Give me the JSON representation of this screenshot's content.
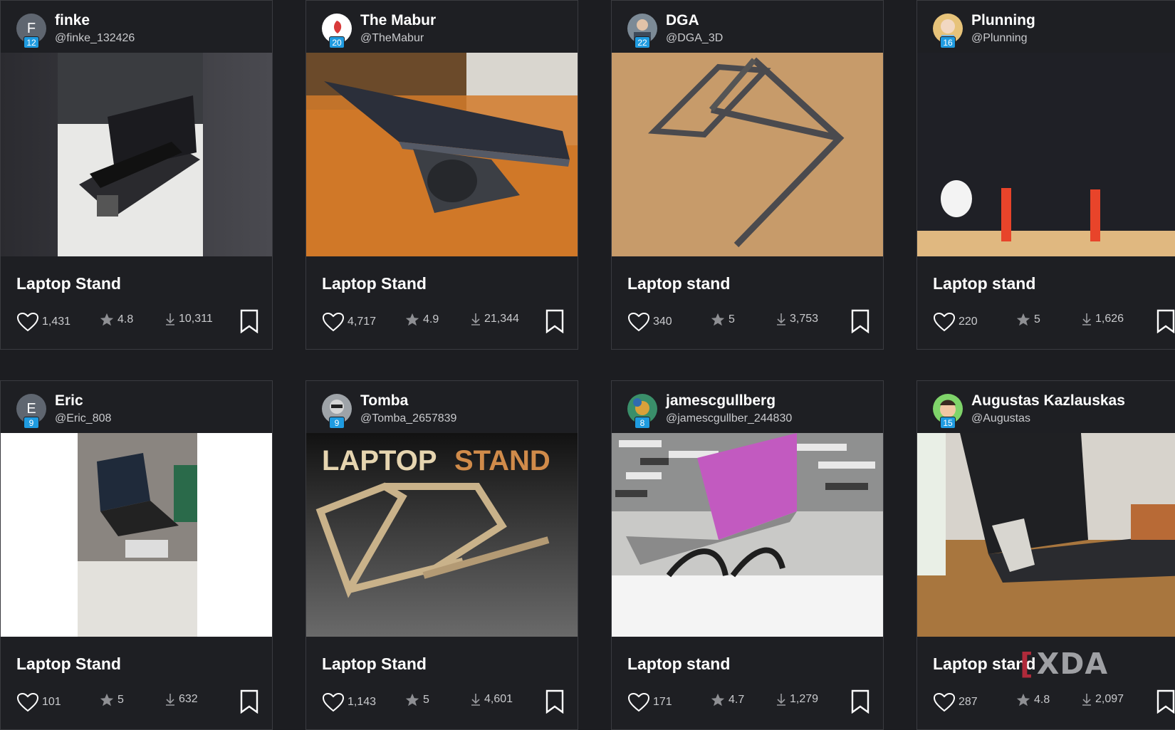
{
  "cards": [
    {
      "user": "finke",
      "handle": "@finke_132426",
      "level": "12",
      "avatar_letter": "F",
      "avatar_color": "#5f6670",
      "title": "Laptop Stand",
      "likes": "1,431",
      "rating": "4.8",
      "downloads": "10,311"
    },
    {
      "user": "The Mabur",
      "handle": "@TheMabur",
      "level": "20",
      "avatar_letter": "",
      "avatar_color": "#ffffff",
      "title": "Laptop Stand",
      "likes": "4,717",
      "rating": "4.9",
      "downloads": "21,344"
    },
    {
      "user": "DGA",
      "handle": "@DGA_3D",
      "level": "22",
      "avatar_letter": "",
      "avatar_color": "#7c8a96",
      "title": "Laptop stand",
      "likes": "340",
      "rating": "5",
      "downloads": "3,753"
    },
    {
      "user": "Plunning",
      "handle": "@Plunning",
      "level": "16",
      "avatar_letter": "",
      "avatar_color": "#e7c37a",
      "title": "Laptop stand",
      "likes": "220",
      "rating": "5",
      "downloads": "1,626"
    },
    {
      "user": "Eric",
      "handle": "@Eric_808",
      "level": "9",
      "avatar_letter": "E",
      "avatar_color": "#5f6670",
      "title": "Laptop Stand",
      "likes": "101",
      "rating": "5",
      "downloads": "632"
    },
    {
      "user": "Tomba",
      "handle": "@Tomba_2657839",
      "level": "9",
      "avatar_letter": "",
      "avatar_color": "#9ea3a8",
      "title": "Laptop Stand",
      "likes": "1,143",
      "rating": "5",
      "downloads": "4,601",
      "image_text": [
        "LAPTOP",
        "STAND"
      ]
    },
    {
      "user": "jamescgullberg",
      "handle": "@jamescgullber_244830",
      "level": "8",
      "avatar_letter": "",
      "avatar_color": "#3a8f6a",
      "title": "Laptop stand",
      "likes": "171",
      "rating": "4.7",
      "downloads": "1,279"
    },
    {
      "user": "Augustas Kazlauskas",
      "handle": "@Augustas",
      "level": "15",
      "avatar_letter": "",
      "avatar_color": "#7fd46a",
      "title": "Laptop stand",
      "likes": "287",
      "rating": "4.8",
      "downloads": "2,097"
    }
  ],
  "icons": {
    "like": "heart-icon",
    "rating": "star-icon",
    "download": "download-icon",
    "save": "bookmark-icon"
  },
  "watermark": "XDA"
}
